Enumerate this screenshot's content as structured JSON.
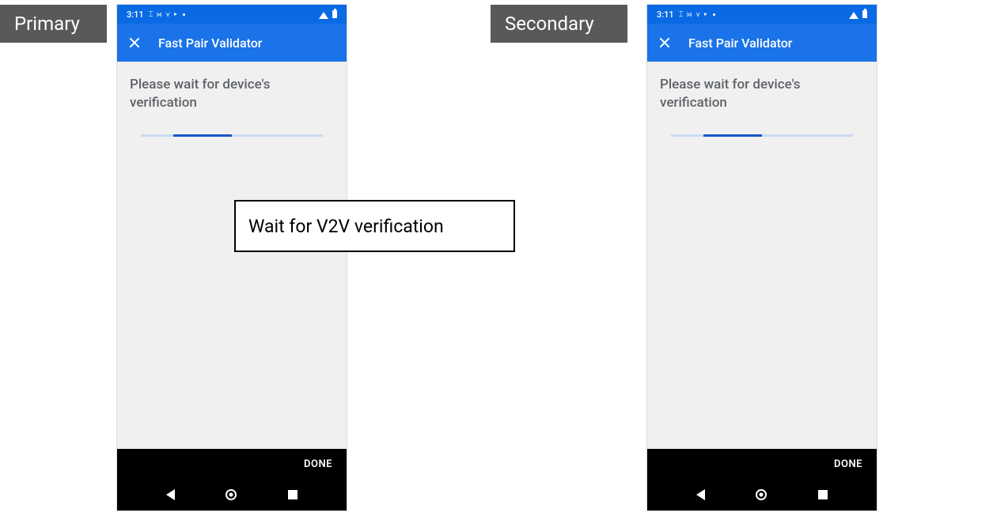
{
  "labels": {
    "primary": "Primary",
    "secondary": "Secondary"
  },
  "callout": "Wait for V2V verification",
  "phones": {
    "primary": {
      "status": {
        "time": "3:11",
        "icons": "⌶ ⋈ ⋎ ▸"
      },
      "app_title": "Fast Pair Validator",
      "wait_text": "Please wait for device's verification",
      "done_label": "DONE"
    },
    "secondary": {
      "status": {
        "time": "3:11",
        "icons": "⌶ ⋈ ⋎ ▸"
      },
      "app_title": "Fast Pair Validator",
      "wait_text": "Please wait for device's verification",
      "done_label": "DONE"
    }
  }
}
